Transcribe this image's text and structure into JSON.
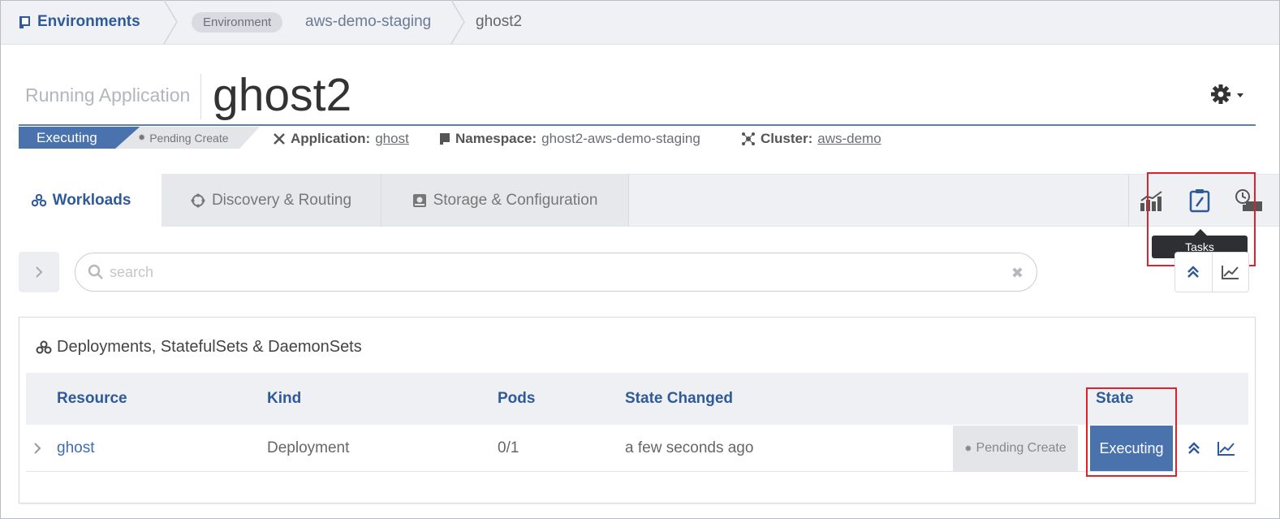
{
  "breadcrumb": {
    "root": "Environments",
    "pill": "Environment",
    "environment": "aws-demo-staging",
    "current": "ghost2"
  },
  "header": {
    "subtitle": "Running Application",
    "title": "ghost2",
    "status": "Executing",
    "pending": "Pending Create",
    "application_label": "Application:",
    "application_value": "ghost",
    "namespace_label": "Namespace:",
    "namespace_value": "ghost2-aws-demo-staging",
    "cluster_label": "Cluster:",
    "cluster_value": "aws-demo"
  },
  "tabs": [
    {
      "label": "Workloads",
      "active": true
    },
    {
      "label": "Discovery & Routing",
      "active": false
    },
    {
      "label": "Storage & Configuration",
      "active": false
    }
  ],
  "tooltip": "Tasks",
  "search": {
    "placeholder": "search",
    "value": ""
  },
  "card": {
    "title": "Deployments, StatefulSets & DaemonSets",
    "columns": [
      "Resource",
      "Kind",
      "Pods",
      "State Changed",
      "State"
    ],
    "rows": [
      {
        "resource": "ghost",
        "kind": "Deployment",
        "pods": "0/1",
        "state_changed": "a few seconds ago",
        "pending": "Pending Create",
        "state": "Executing"
      }
    ]
  },
  "colors": {
    "accent": "#2f5a9a",
    "status_blue": "#4a72ad",
    "highlight": "#d9232e"
  },
  "icons": [
    "environments-icon",
    "gear-icon",
    "workloads-icon",
    "discovery-icon",
    "storage-icon",
    "metrics-icon",
    "tasks-icon",
    "history-icon",
    "search-icon",
    "clear-icon",
    "collapse-icon",
    "chart-icon"
  ]
}
